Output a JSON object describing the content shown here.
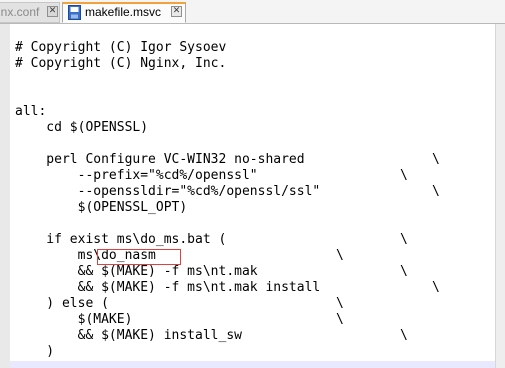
{
  "tabs": [
    {
      "label": "inx.conf",
      "active": false
    },
    {
      "label": "makefile.msvc",
      "active": true
    }
  ],
  "colors": {
    "active_tab_accent": "#f2a23c",
    "highlight_box": "#e04040",
    "current_line": "#e8e8ff"
  },
  "code_lines": [
    "# Copyright (C) Igor Sysoev",
    "# Copyright (C) Nginx, Inc.",
    "all:",
    "    cd $(OPENSSL)",
    "    perl Configure VC-WIN32 no-shared",
    "        --prefix=\"%cd%/openssl\"",
    "        --openssldir=\"%cd%/openssl/ssl\"",
    "        $(OPENSSL_OPT)",
    "    if exist ms\\do_ms.bat (",
    "        ms\\do_nasm",
    "        && $(MAKE) -f ms\\nt.mak",
    "        && $(MAKE) -f ms\\nt.mak install",
    "    ) else (",
    "        $(MAKE)",
    "        && $(MAKE) install_sw",
    "    )"
  ],
  "continuation_char": "\\"
}
